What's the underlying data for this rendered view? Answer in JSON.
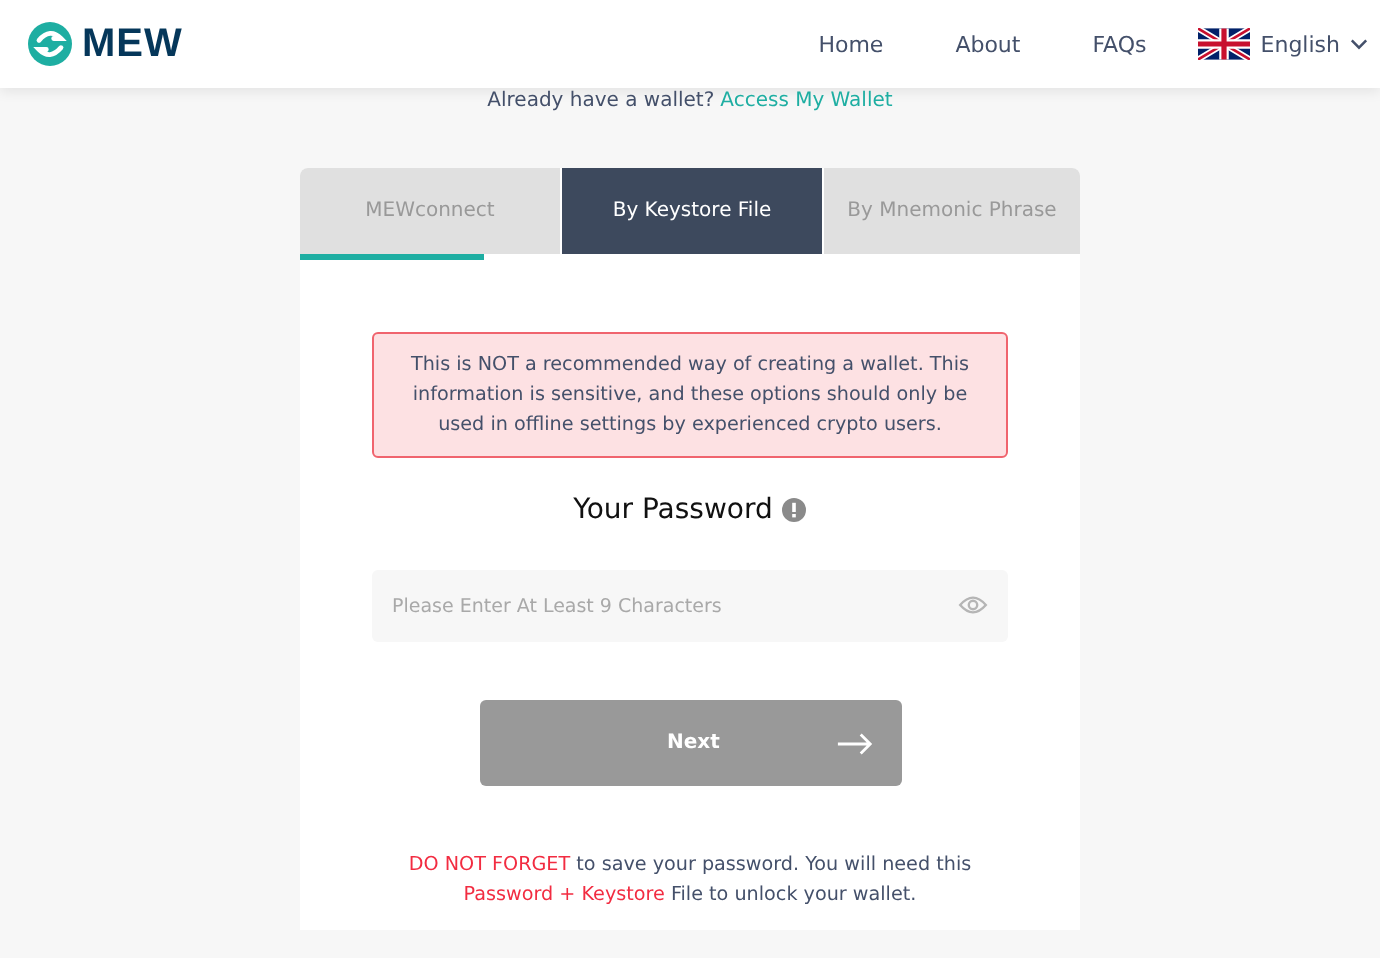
{
  "header": {
    "logo": "MEW",
    "nav": [
      {
        "label": "Home"
      },
      {
        "label": "About"
      },
      {
        "label": "FAQs"
      }
    ],
    "language": {
      "label": "English"
    }
  },
  "prompt": {
    "text": "Already have a wallet?",
    "link": "Access My Wallet"
  },
  "tabs": [
    {
      "label": "MEWconnect",
      "selected": false
    },
    {
      "label": "By Keystore File",
      "selected": true
    },
    {
      "label": "By Mnemonic Phrase",
      "selected": false
    }
  ],
  "progress": {
    "level": 0.236
  },
  "warning": "This is NOT a recommended way of creating a wallet. This information is sensitive, and these options should only be used in offline settings by experienced crypto users.",
  "password": {
    "title": "Your Password",
    "placeholder": "Please Enter At Least 9 Characters"
  },
  "next_button": {
    "label": "Next",
    "disabled": true
  },
  "note": [
    {
      "text": "DO NOT FORGET",
      "highlight": true
    },
    {
      "text": " to save your password. You will need this ",
      "highlight": false
    },
    {
      "text": "Password + Keystore",
      "highlight": true
    },
    {
      "text": " File to unlock your wallet.",
      "highlight": false
    }
  ]
}
